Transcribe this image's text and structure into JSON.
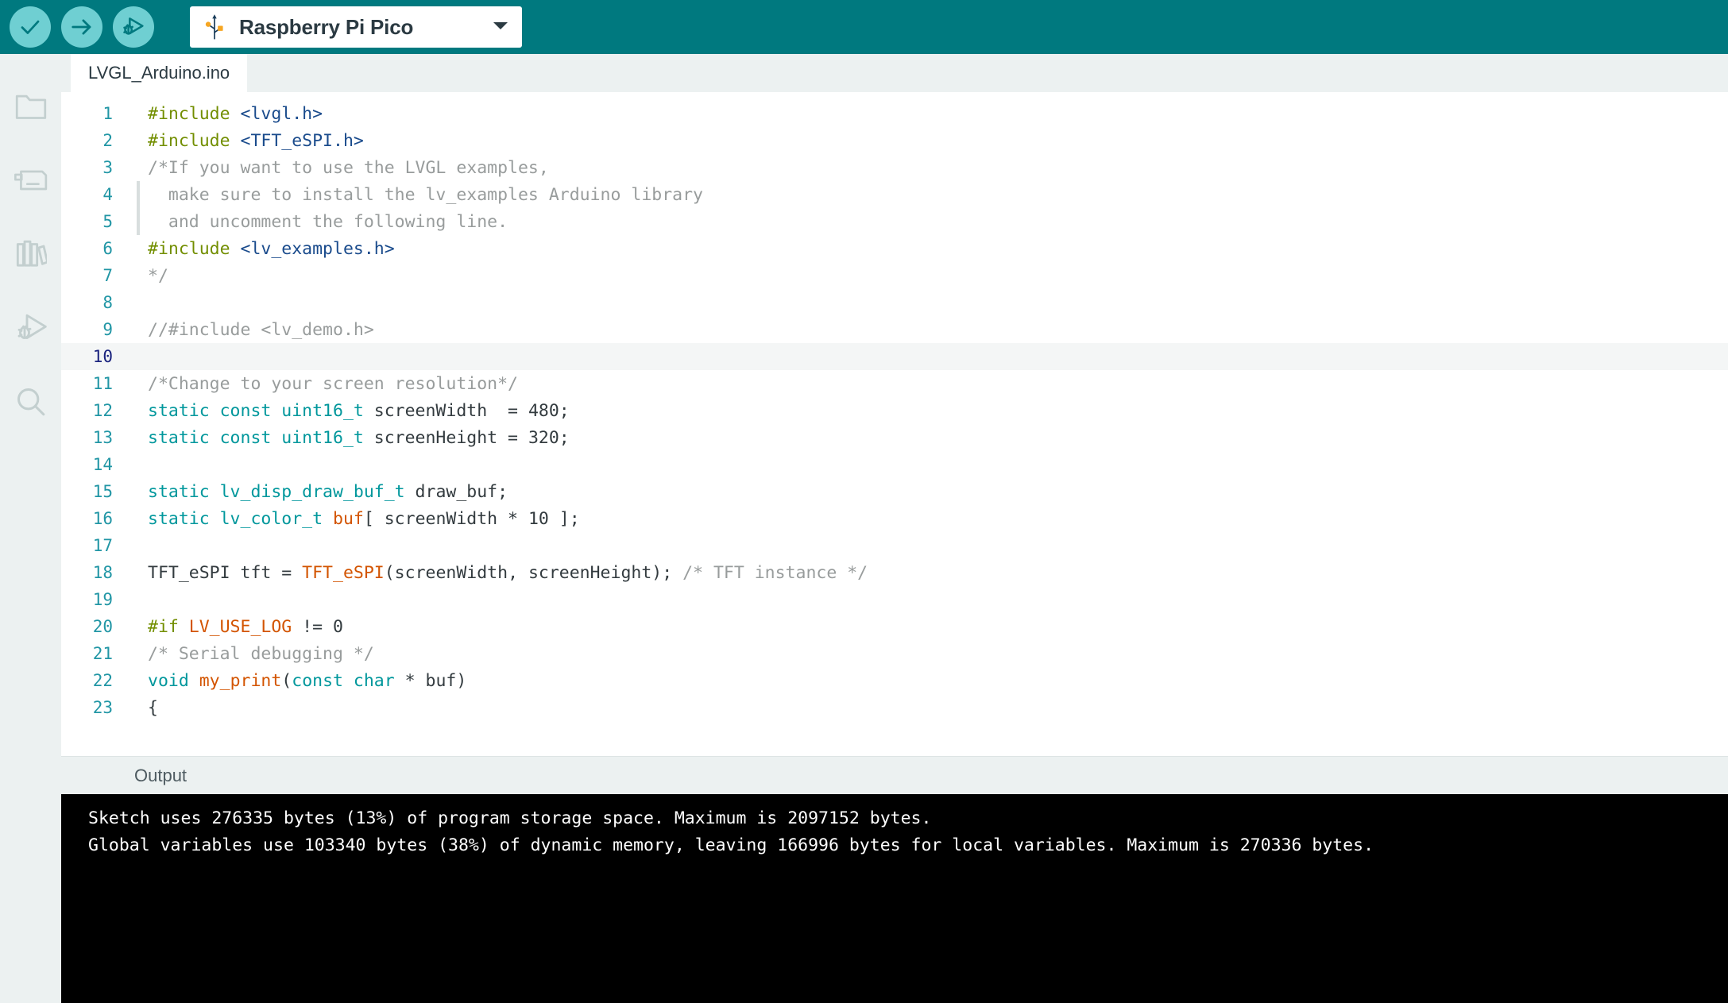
{
  "toolbar": {
    "verify_label": "Verify",
    "upload_label": "Upload",
    "debug_label": "Debug",
    "board": {
      "name": "Raspberry Pi Pico",
      "icon": "usb-icon",
      "caret": "chevron-down-icon"
    },
    "background_color": "#00797f",
    "button_color": "#6fcfd2"
  },
  "activity_bar": {
    "items": [
      {
        "name": "sketchbook",
        "icon": "folder-icon"
      },
      {
        "name": "boards-manager",
        "icon": "board-chip-icon"
      },
      {
        "name": "library-manager",
        "icon": "books-icon"
      },
      {
        "name": "debug",
        "icon": "bug-play-icon"
      },
      {
        "name": "search",
        "icon": "magnifier-icon"
      }
    ]
  },
  "editor": {
    "tab_label": "LVGL_Arduino.ino",
    "active_line": 10,
    "lines": [
      {
        "n": 1,
        "indent": false,
        "tokens": [
          {
            "t": "#include ",
            "c": "c-pre"
          },
          {
            "t": "<lvgl.h>",
            "c": "c-inc"
          }
        ]
      },
      {
        "n": 2,
        "indent": false,
        "tokens": [
          {
            "t": "#include ",
            "c": "c-pre"
          },
          {
            "t": "<TFT_eSPI.h>",
            "c": "c-inc"
          }
        ]
      },
      {
        "n": 3,
        "indent": false,
        "tokens": [
          {
            "t": "/*If you want to use the LVGL examples,",
            "c": "c-com"
          }
        ]
      },
      {
        "n": 4,
        "indent": true,
        "tokens": [
          {
            "t": "  make sure to install the lv_examples Arduino library",
            "c": "c-com"
          }
        ]
      },
      {
        "n": 5,
        "indent": true,
        "tokens": [
          {
            "t": "  and uncomment the following line.",
            "c": "c-com"
          }
        ]
      },
      {
        "n": 6,
        "indent": false,
        "tokens": [
          {
            "t": "#include ",
            "c": "c-pre"
          },
          {
            "t": "<lv_examples.h>",
            "c": "c-inc"
          }
        ]
      },
      {
        "n": 7,
        "indent": false,
        "tokens": [
          {
            "t": "*/",
            "c": "c-com"
          }
        ]
      },
      {
        "n": 8,
        "indent": false,
        "tokens": [
          {
            "t": "",
            "c": "c-plain"
          }
        ]
      },
      {
        "n": 9,
        "indent": false,
        "tokens": [
          {
            "t": "//#include <lv_demo.h>",
            "c": "c-com"
          }
        ]
      },
      {
        "n": 10,
        "indent": false,
        "tokens": [
          {
            "t": "",
            "c": "c-plain"
          }
        ]
      },
      {
        "n": 11,
        "indent": false,
        "tokens": [
          {
            "t": "/*Change to your screen resolution*/",
            "c": "c-com"
          }
        ]
      },
      {
        "n": 12,
        "indent": false,
        "tokens": [
          {
            "t": "static const uint16_t",
            "c": "c-kw"
          },
          {
            "t": " screenWidth  = ",
            "c": "c-plain"
          },
          {
            "t": "480",
            "c": "c-num"
          },
          {
            "t": ";",
            "c": "c-plain"
          }
        ]
      },
      {
        "n": 13,
        "indent": false,
        "tokens": [
          {
            "t": "static const uint16_t",
            "c": "c-kw"
          },
          {
            "t": " screenHeight = ",
            "c": "c-plain"
          },
          {
            "t": "320",
            "c": "c-num"
          },
          {
            "t": ";",
            "c": "c-plain"
          }
        ]
      },
      {
        "n": 14,
        "indent": false,
        "tokens": [
          {
            "t": "",
            "c": "c-plain"
          }
        ]
      },
      {
        "n": 15,
        "indent": false,
        "tokens": [
          {
            "t": "static lv_disp_draw_buf_t",
            "c": "c-kw"
          },
          {
            "t": " draw_buf;",
            "c": "c-plain"
          }
        ]
      },
      {
        "n": 16,
        "indent": false,
        "tokens": [
          {
            "t": "static lv_color_t ",
            "c": "c-kw"
          },
          {
            "t": "buf",
            "c": "c-fn"
          },
          {
            "t": "[ screenWidth * ",
            "c": "c-plain"
          },
          {
            "t": "10",
            "c": "c-num"
          },
          {
            "t": " ];",
            "c": "c-plain"
          }
        ]
      },
      {
        "n": 17,
        "indent": false,
        "tokens": [
          {
            "t": "",
            "c": "c-plain"
          }
        ]
      },
      {
        "n": 18,
        "indent": false,
        "tokens": [
          {
            "t": "TFT_eSPI tft = ",
            "c": "c-plain"
          },
          {
            "t": "TFT_eSPI",
            "c": "c-fn"
          },
          {
            "t": "(screenWidth, screenHeight); ",
            "c": "c-plain"
          },
          {
            "t": "/* TFT instance */",
            "c": "c-com"
          }
        ]
      },
      {
        "n": 19,
        "indent": false,
        "tokens": [
          {
            "t": "",
            "c": "c-plain"
          }
        ]
      },
      {
        "n": 20,
        "indent": false,
        "tokens": [
          {
            "t": "#if ",
            "c": "c-pre"
          },
          {
            "t": "LV_USE_LOG",
            "c": "c-fn"
          },
          {
            "t": " != ",
            "c": "c-plain"
          },
          {
            "t": "0",
            "c": "c-num"
          }
        ]
      },
      {
        "n": 21,
        "indent": false,
        "tokens": [
          {
            "t": "/* Serial debugging */",
            "c": "c-com"
          }
        ]
      },
      {
        "n": 22,
        "indent": false,
        "tokens": [
          {
            "t": "void ",
            "c": "c-kw"
          },
          {
            "t": "my_print",
            "c": "c-fn"
          },
          {
            "t": "(",
            "c": "c-plain"
          },
          {
            "t": "const char",
            "c": "c-kw"
          },
          {
            "t": " * buf)",
            "c": "c-plain"
          }
        ]
      },
      {
        "n": 23,
        "indent": false,
        "tokens": [
          {
            "t": "{",
            "c": "c-plain"
          }
        ]
      }
    ]
  },
  "output": {
    "title": "Output",
    "lines": [
      "Sketch uses 276335 bytes (13%) of program storage space. Maximum is 2097152 bytes.",
      "Global variables use 103340 bytes (38%) of dynamic memory, leaving 166996 bytes for local variables. Maximum is 270336 bytes."
    ]
  }
}
